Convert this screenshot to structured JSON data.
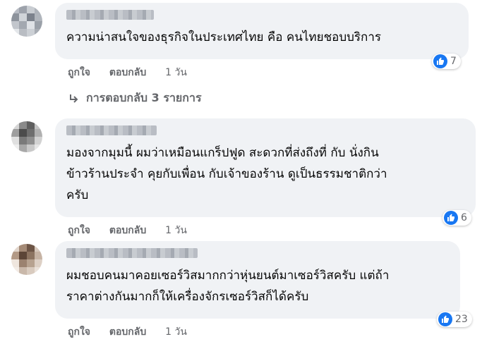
{
  "colors": {
    "like_blue": "#1877f2",
    "bubble_bg": "#f0f2f5",
    "meta_text": "#65676b"
  },
  "comments": [
    {
      "text_lines": [
        "ความน่าสนใจของธุรกิจในประเทศไทย คือ คนไทยชอบบริการ"
      ],
      "reaction_icon": "like-icon",
      "reaction_count": "7",
      "like_label": "ถูกใจ",
      "reply_label": "ตอบกลับ",
      "time": "1 วัน"
    },
    {
      "text_lines": [
        "มองจากมุมนี้ ผมว่าเหมือนแกร็ปฟูด สะดวกที่ส่งถึงที่ กับ นั่งกิน",
        "ข้าวร้านประจำ คุยกับเพื่อน กับเจ้าของร้าน ดูเป็นธรรมชาติกว่า",
        "ครับ"
      ],
      "reaction_icon": "like-icon",
      "reaction_count": "6",
      "like_label": "ถูกใจ",
      "reply_label": "ตอบกลับ",
      "time": "1 วัน"
    },
    {
      "text_lines": [
        "ผมชอบคนมาคอยเซอร์วิสมากกว่าหุ่นยนต์มาเซอร์วิสครับ แต่ถ้า",
        "ราคาต่างกันมากก็ให้เครื่องจักรเซอร์วิสก็ได้ครับ"
      ],
      "reaction_icon": "like-icon",
      "reaction_count": "23",
      "like_label": "ถูกใจ",
      "reply_label": "ตอบกลับ",
      "time": "1 วัน"
    }
  ],
  "view_replies": {
    "icon": "reply-arrow-icon",
    "label": "การตอบกลับ 3 รายการ"
  }
}
